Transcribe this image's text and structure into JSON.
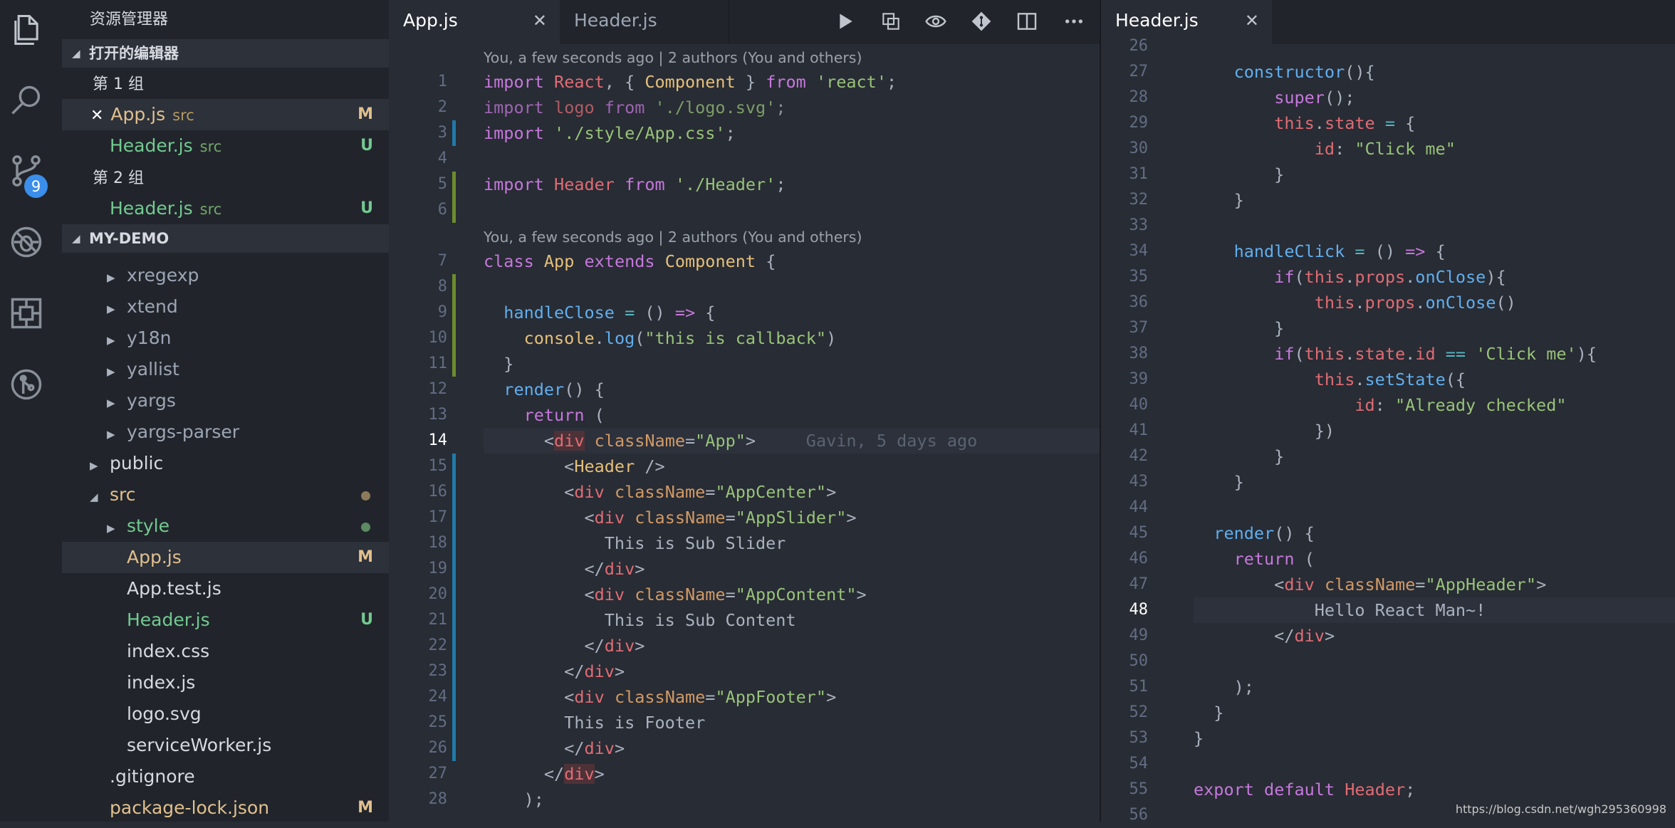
{
  "activity": {
    "badge": "9"
  },
  "sidebar": {
    "title": "资源管理器",
    "open_editors_label": "打开的编辑器",
    "group1_label": "第 1 组",
    "group2_label": "第 2 组",
    "open1": {
      "name": "App.js",
      "dir": "src",
      "status": "M"
    },
    "open2": {
      "name": "Header.js",
      "dir": "src",
      "status": "U"
    },
    "open3": {
      "name": "Header.js",
      "dir": "src",
      "status": "U"
    },
    "project_label": "MY-DEMO",
    "tree": [
      {
        "name": "xregexp"
      },
      {
        "name": "xtend"
      },
      {
        "name": "y18n"
      },
      {
        "name": "yallist"
      },
      {
        "name": "yargs"
      },
      {
        "name": "yargs-parser"
      },
      {
        "name": "public"
      },
      {
        "name": "src"
      },
      {
        "name": "style"
      },
      {
        "name": "App.js",
        "status": "M"
      },
      {
        "name": "App.test.js"
      },
      {
        "name": "Header.js",
        "status": "U"
      },
      {
        "name": "index.css"
      },
      {
        "name": "index.js"
      },
      {
        "name": "logo.svg"
      },
      {
        "name": "serviceWorker.js"
      },
      {
        "name": ".gitignore"
      },
      {
        "name": "package-lock.json",
        "status": "M"
      }
    ]
  },
  "editor1": {
    "tab_active": "App.js",
    "tab_inactive": "Header.js",
    "close_glyph": "✕",
    "lens1": "You, a few seconds ago | 2 authors (You and others)",
    "lens2": "You, a few seconds ago | 2 authors (You and others)",
    "line_numbers": [
      "1",
      "2",
      "3",
      "4",
      "5",
      "6",
      "7",
      "8",
      "9",
      "10",
      "11",
      "12",
      "13",
      "14",
      "15",
      "16",
      "17",
      "18",
      "19",
      "20",
      "21",
      "22",
      "23",
      "24",
      "25",
      "26",
      "27",
      "28"
    ],
    "current_line": "14",
    "blame": "Gavin, 5 days ago"
  },
  "editor2": {
    "tab_active": "Header.js",
    "close_glyph": "✕",
    "line_numbers": [
      "26",
      "27",
      "28",
      "29",
      "30",
      "31",
      "32",
      "33",
      "34",
      "35",
      "36",
      "37",
      "38",
      "39",
      "40",
      "41",
      "42",
      "43",
      "44",
      "45",
      "46",
      "47",
      "48",
      "49",
      "50",
      "51",
      "52",
      "53",
      "54",
      "55",
      "56"
    ],
    "current_line": "48"
  },
  "watermark": "https://blog.csdn.net/wgh295360998"
}
